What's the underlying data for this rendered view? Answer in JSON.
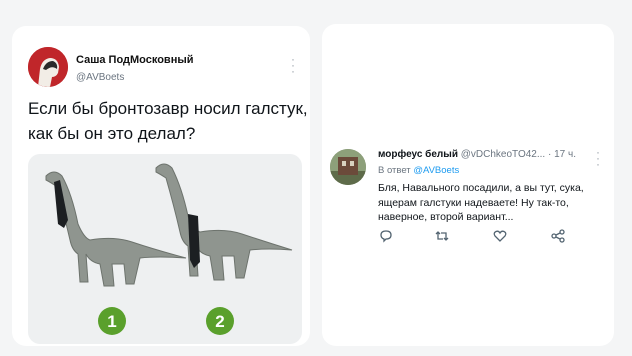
{
  "tweet": {
    "author_name": "Саша ПодМосковный",
    "author_handle": "@AVBoets",
    "text_line1": "Если бы бронтозавр носил галстук,",
    "text_line2": "как бы он это делал?",
    "media": {
      "option_1": "1",
      "option_2": "2",
      "badge_color": "#5aa02c"
    }
  },
  "reply": {
    "author_name": "морфеус белый",
    "author_handle": "@vDChkeoTO42...",
    "time": "· 17 ч.",
    "reply_to_label": "В ответ",
    "reply_to_handle": "@AVBoets",
    "text_line1": "Бля, Навального посадили, а вы тут, сука,",
    "text_line2": "ящерам галстуки надеваете! Ну так-то,",
    "text_line3": "наверное, второй вариант...",
    "actions": [
      "reply-icon",
      "retweet-icon",
      "like-icon",
      "share-icon"
    ],
    "accent_color": "#1d9bf0"
  }
}
